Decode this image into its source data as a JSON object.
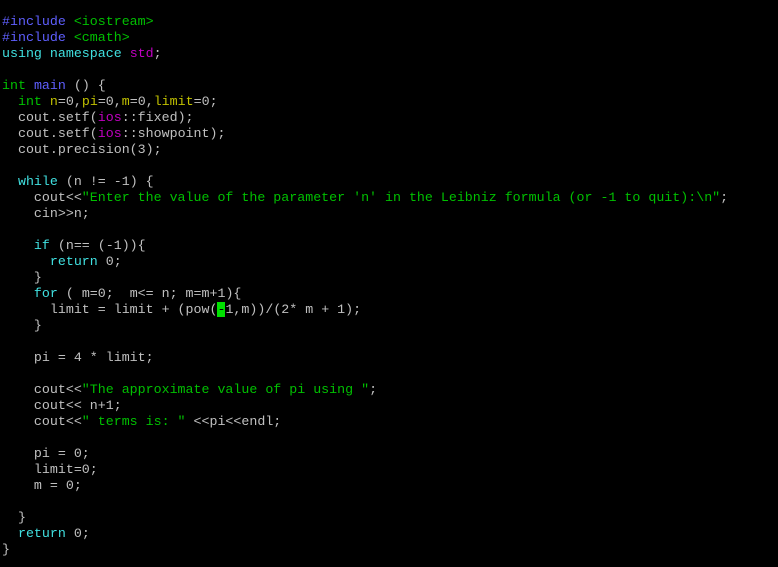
{
  "editor": {
    "cursor": {
      "line": 19,
      "char": "-"
    },
    "colors": {
      "background": "#000000",
      "plain": "#c0c0c0",
      "preproc": "#5f5fff",
      "string": "#00c000",
      "keyword": "#40e0e0",
      "type": "#00c000",
      "namespace": "#c000c0",
      "variable": "#c0c000",
      "cursor": "#00e000"
    },
    "lines": [
      [
        {
          "t": "preproc",
          "v": "#include"
        },
        {
          "t": "plain",
          "v": " "
        },
        {
          "t": "string",
          "v": "<iostream>"
        }
      ],
      [
        {
          "t": "preproc",
          "v": "#include"
        },
        {
          "t": "plain",
          "v": " "
        },
        {
          "t": "string",
          "v": "<cmath>"
        }
      ],
      [
        {
          "t": "keyword",
          "v": "using namespace"
        },
        {
          "t": "plain",
          "v": " "
        },
        {
          "t": "ns",
          "v": "std"
        },
        {
          "t": "plain",
          "v": ";"
        }
      ],
      [],
      [
        {
          "t": "type",
          "v": "int"
        },
        {
          "t": "plain",
          "v": " "
        },
        {
          "t": "func",
          "v": "main"
        },
        {
          "t": "plain",
          "v": " () {"
        }
      ],
      [
        {
          "t": "plain",
          "v": "  "
        },
        {
          "t": "type",
          "v": "int"
        },
        {
          "t": "plain",
          "v": " "
        },
        {
          "t": "var",
          "v": "n"
        },
        {
          "t": "plain",
          "v": "=0,"
        },
        {
          "t": "var",
          "v": "pi"
        },
        {
          "t": "plain",
          "v": "=0,"
        },
        {
          "t": "var",
          "v": "m"
        },
        {
          "t": "plain",
          "v": "=0,"
        },
        {
          "t": "var",
          "v": "limit"
        },
        {
          "t": "plain",
          "v": "=0;"
        }
      ],
      [
        {
          "t": "plain",
          "v": "  cout.setf("
        },
        {
          "t": "ns",
          "v": "ios"
        },
        {
          "t": "plain",
          "v": "::fixed);"
        }
      ],
      [
        {
          "t": "plain",
          "v": "  cout.setf("
        },
        {
          "t": "ns",
          "v": "ios"
        },
        {
          "t": "plain",
          "v": "::showpoint);"
        }
      ],
      [
        {
          "t": "plain",
          "v": "  cout.precision(3);"
        }
      ],
      [],
      [
        {
          "t": "plain",
          "v": "  "
        },
        {
          "t": "keyword",
          "v": "while"
        },
        {
          "t": "plain",
          "v": " (n != -1) {"
        }
      ],
      [
        {
          "t": "plain",
          "v": "    cout<<"
        },
        {
          "t": "string",
          "v": "\"Enter the value of the parameter 'n' in the Leibniz formula (or -1 to quit):\\n\""
        },
        {
          "t": "plain",
          "v": ";"
        }
      ],
      [
        {
          "t": "plain",
          "v": "    cin>>n;"
        }
      ],
      [],
      [
        {
          "t": "plain",
          "v": "    "
        },
        {
          "t": "keyword",
          "v": "if"
        },
        {
          "t": "plain",
          "v": " (n== (-1)){"
        }
      ],
      [
        {
          "t": "plain",
          "v": "      "
        },
        {
          "t": "keyword",
          "v": "return"
        },
        {
          "t": "plain",
          "v": " 0;"
        }
      ],
      [
        {
          "t": "plain",
          "v": "    }"
        }
      ],
      [
        {
          "t": "plain",
          "v": "    "
        },
        {
          "t": "keyword",
          "v": "for"
        },
        {
          "t": "plain",
          "v": " ( m=0;  m<= n; m=m+1){"
        }
      ],
      [
        {
          "t": "plain",
          "v": "      limit = limit + (pow("
        },
        {
          "t": "cursor",
          "v": "-"
        },
        {
          "t": "plain",
          "v": "1,m))/(2* m + 1);"
        }
      ],
      [
        {
          "t": "plain",
          "v": "    }"
        }
      ],
      [],
      [
        {
          "t": "plain",
          "v": "    pi = 4 * limit;"
        }
      ],
      [],
      [
        {
          "t": "plain",
          "v": "    cout<<"
        },
        {
          "t": "string",
          "v": "\"The approximate value of pi using \""
        },
        {
          "t": "plain",
          "v": ";"
        }
      ],
      [
        {
          "t": "plain",
          "v": "    cout<< n+1;"
        }
      ],
      [
        {
          "t": "plain",
          "v": "    cout<<"
        },
        {
          "t": "string",
          "v": "\" terms is: \""
        },
        {
          "t": "plain",
          "v": " <<pi<<endl;"
        }
      ],
      [],
      [
        {
          "t": "plain",
          "v": "    pi = 0;"
        }
      ],
      [
        {
          "t": "plain",
          "v": "    limit=0;"
        }
      ],
      [
        {
          "t": "plain",
          "v": "    m = 0;"
        }
      ],
      [],
      [
        {
          "t": "plain",
          "v": "  }"
        }
      ],
      [
        {
          "t": "plain",
          "v": "  "
        },
        {
          "t": "keyword",
          "v": "return"
        },
        {
          "t": "plain",
          "v": " 0;"
        }
      ],
      [
        {
          "t": "plain",
          "v": "}"
        }
      ]
    ]
  }
}
